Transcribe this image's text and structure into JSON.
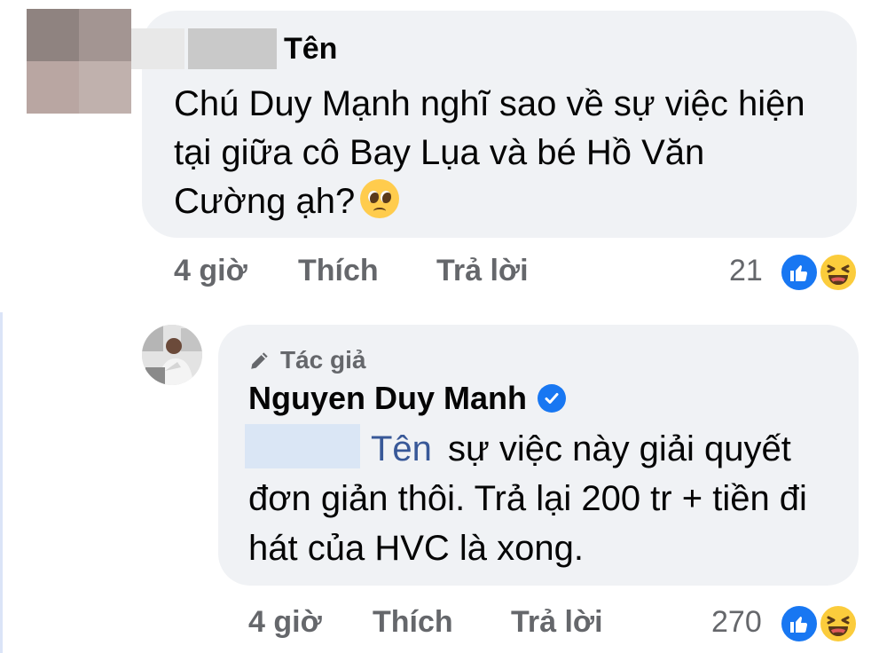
{
  "comment": {
    "author_name": "Tên",
    "text": "Chú Duy Mạnh nghĩ sao về sự việc hiện tại giữa cô Bay Lụa và bé Hồ Văn Cường ạh?",
    "emoji": "pleading-face-emoji",
    "time": "4 giờ",
    "like_label": "Thích",
    "reply_label": "Trả lời",
    "reaction_count": "21",
    "reactions": [
      "like-icon",
      "haha-icon"
    ]
  },
  "reply": {
    "badge": "Tác giả",
    "author_name": "Nguyen Duy Manh",
    "verified": true,
    "mention": "Tên",
    "text": "sự việc này giải quyết đơn giản thôi. Trả lại 200 tr + tiền đi hát của HVC là xong.",
    "time": "4 giờ",
    "like_label": "Thích",
    "reply_label": "Trả lời",
    "reaction_count": "270",
    "reactions": [
      "like-icon",
      "haha-icon"
    ]
  },
  "colors": {
    "bubble": "#f0f2f5",
    "meta_text": "#65676b",
    "like_blue": "#1877f2",
    "mention": "#385898"
  }
}
